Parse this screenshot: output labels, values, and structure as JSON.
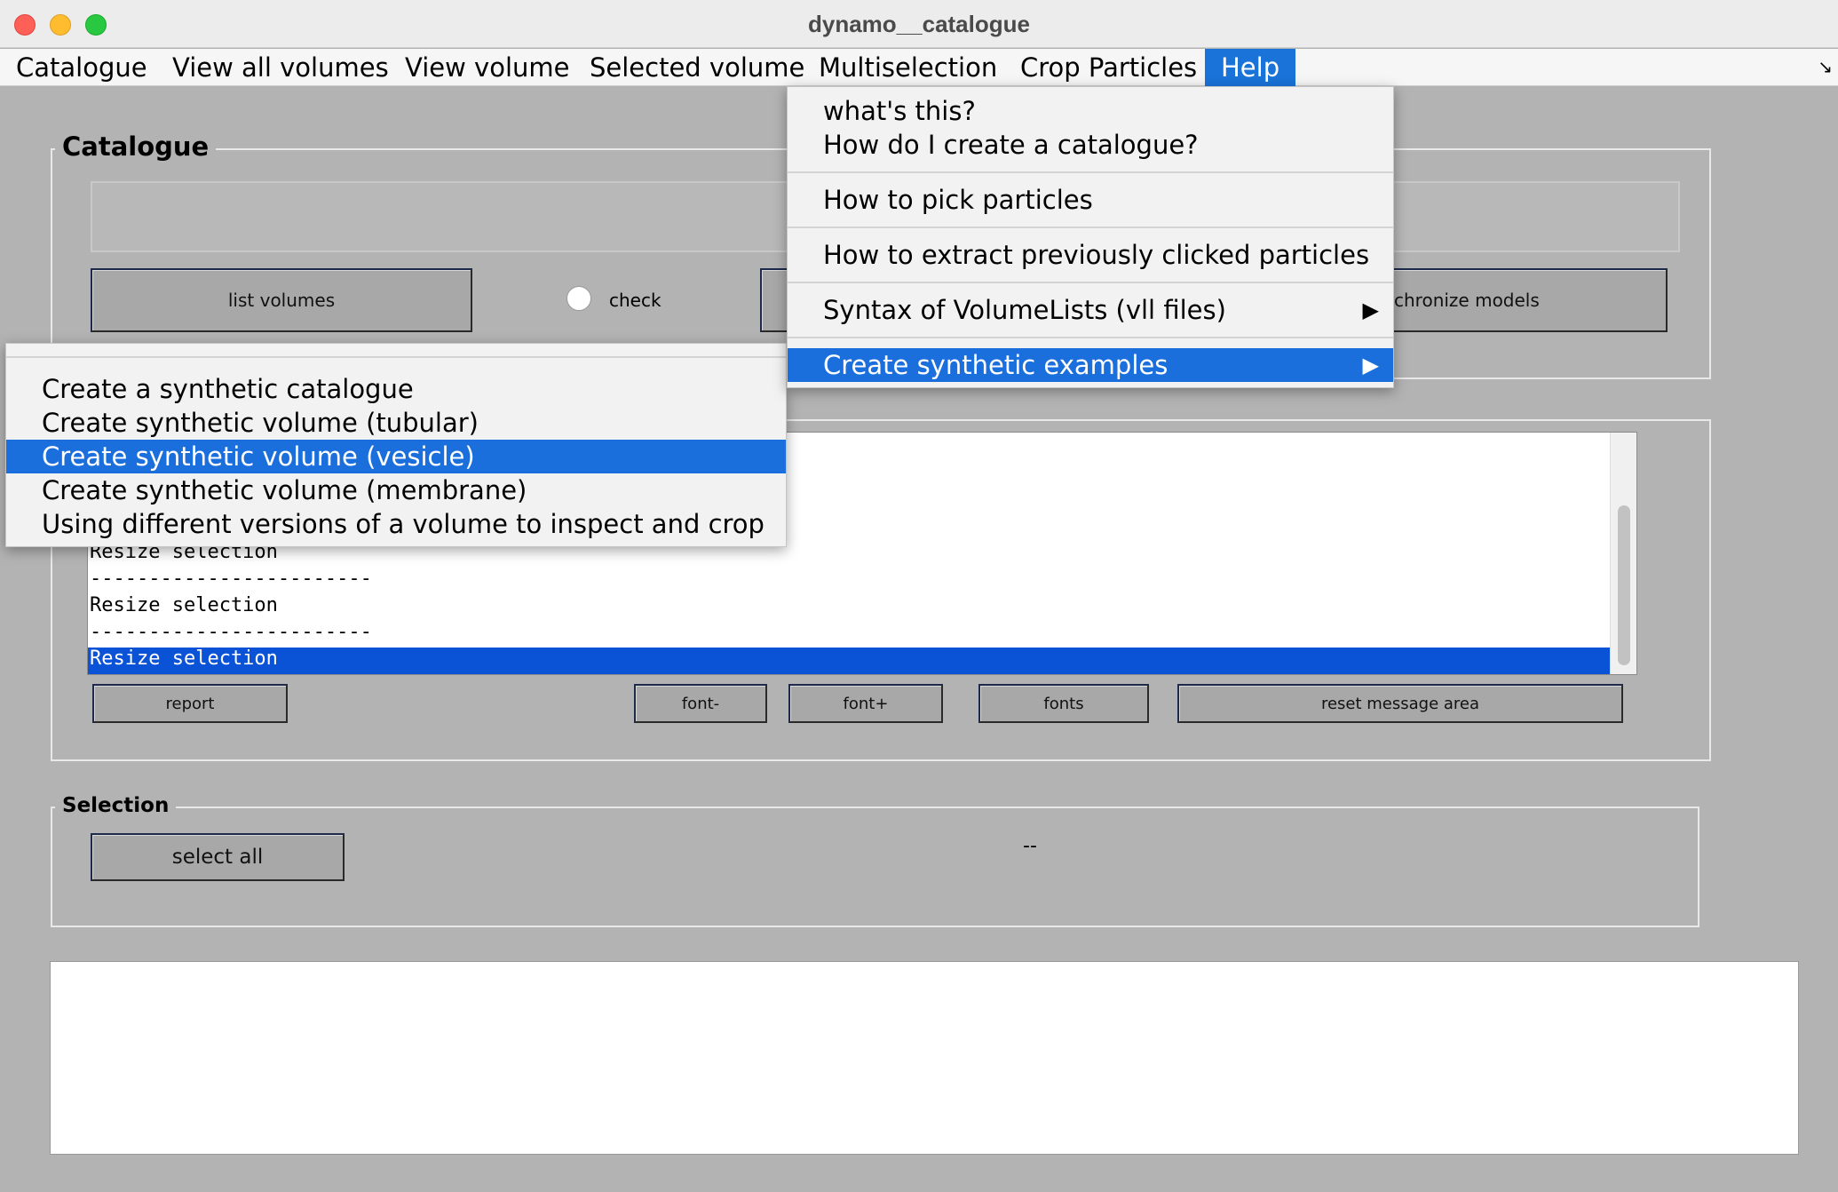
{
  "window": {
    "title": "dynamo__catalogue"
  },
  "menubar": {
    "items": [
      "Catalogue",
      "View all volumes",
      "View volume",
      "Selected volume",
      "Multiselection",
      "Crop Particles",
      "Help"
    ],
    "active": "Help"
  },
  "help_menu": {
    "items": [
      "what's this?",
      "How do I create a catalogue?",
      "How to pick particles",
      "How to extract previously clicked particles",
      "Syntax of VolumeLists (vll files)",
      "Create synthetic examples"
    ],
    "highlighted": "Create synthetic examples"
  },
  "synthetic_submenu": {
    "items": [
      "Create a synthetic catalogue",
      "Create synthetic volume (tubular)",
      "Create synthetic volume (vesicle)",
      "Create synthetic volume (membrane)",
      "Using different versions of a volume to inspect and crop"
    ],
    "highlighted": "Create synthetic volume (vesicle)"
  },
  "catalogue_panel": {
    "title": "Catalogue",
    "list_volumes_label": "list volumes",
    "check_label": "check",
    "synchronize_label": "chronize models"
  },
  "messages_panel": {
    "lines": [
      "Resize selection",
      "------------------------",
      "Resize selection",
      "------------------------",
      "Resize selection"
    ],
    "buttons": {
      "report": "report",
      "font_minus": "font-",
      "font_plus": "font+",
      "fonts": "fonts",
      "reset": "reset message area"
    }
  },
  "selection_panel": {
    "title": "Selection",
    "select_all_label": "select all",
    "status": "--"
  },
  "colors": {
    "background": "#b3b3b3",
    "menu_highlight": "#1a73d9",
    "list_selection": "#0b53d6"
  }
}
